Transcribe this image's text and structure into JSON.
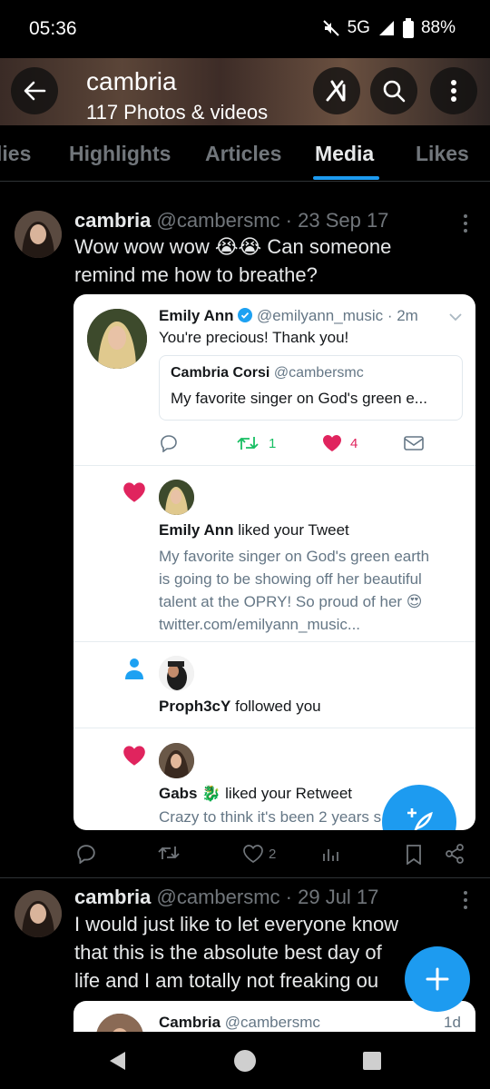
{
  "status": {
    "time": "05:36",
    "network": "5G",
    "battery": "88%"
  },
  "header": {
    "title": "cambria",
    "subtitle": "117 Photos & videos"
  },
  "tabs": [
    {
      "label": "Replies",
      "shown": "lies"
    },
    {
      "label": "Highlights",
      "shown": "Highlights"
    },
    {
      "label": "Articles",
      "shown": "Articles"
    },
    {
      "label": "Media",
      "shown": "Media",
      "active": true
    },
    {
      "label": "Likes",
      "shown": "Likes"
    }
  ],
  "tweet1": {
    "name": "cambria",
    "handle": "@cambersmc",
    "date": "· 23 Sep 17",
    "text_line1": "Wow wow wow 😭😭 Can someone",
    "text_line2": "remind me how to breathe?",
    "likes": "2"
  },
  "screenshot": {
    "reply": {
      "name": "Emily Ann",
      "handle": "@emilyann_music · 2m",
      "text": "You're precious! Thank you!",
      "quoted_name": "Cambria Corsi",
      "quoted_handle": "@cambersmc",
      "quoted_text": "My favorite singer on God's green e...",
      "retweets": "1",
      "likes": "4"
    },
    "notif1": {
      "name": "Emily Ann",
      "action": "liked your Tweet",
      "line1": "My favorite singer on God's green earth",
      "line2": "is going to be showing off her beautiful",
      "line3": "talent at the OPRY! So proud of her 😍",
      "line4": "twitter.com/emilyann_music..."
    },
    "notif2": {
      "name": "Proph3cY",
      "action": "followed you"
    },
    "notif3": {
      "name": "Gabs 🐉",
      "action": "liked your Retweet",
      "line1": "Crazy to think it's been 2 years s"
    }
  },
  "tweet2": {
    "name": "cambria",
    "handle": "@cambersmc",
    "date": "· 29 Jul 17",
    "text_line1": "I would just like to let everyone know",
    "text_line2": "that this is the absolute best day of",
    "text_line3": "life and I am totally not freaking ou",
    "embed_name": "Cambria",
    "embed_handle": "@cambersmc",
    "embed_time": "1d"
  },
  "colors": {
    "accent": "#1d9bf0",
    "like": "#e0245e",
    "retweet": "#17bf63"
  }
}
